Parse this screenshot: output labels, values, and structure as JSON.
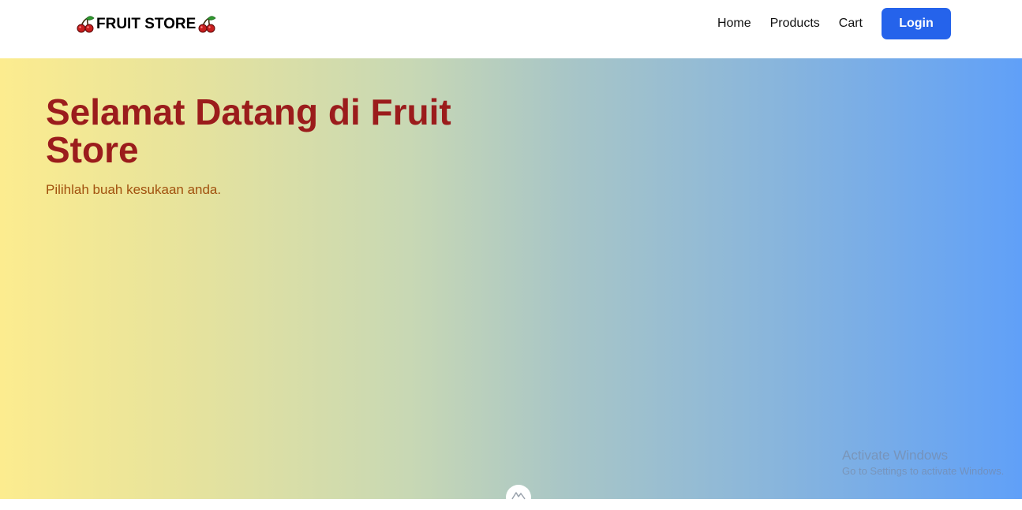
{
  "navbar": {
    "brand": {
      "text": "FRUIT STORE",
      "left_icon": "cherry-icon",
      "right_icon": "cherry-icon"
    },
    "links": [
      {
        "label": "Home"
      },
      {
        "label": "Products"
      },
      {
        "label": "Cart"
      }
    ],
    "login_label": "Login"
  },
  "hero": {
    "title": "Selamat Datang di Fruit Store",
    "subtitle": "Pilihlah buah kesukaan anda.",
    "scroll_icon": "mountain-icon"
  },
  "watermark": {
    "title": "Activate Windows",
    "subtitle": "Go to Settings to activate Windows."
  },
  "colors": {
    "accent": "#2563eb",
    "title": "#9b1c1c",
    "subtitle": "#a1510e",
    "gradient_start": "#fcec8f",
    "gradient_end": "#60a0f8"
  }
}
